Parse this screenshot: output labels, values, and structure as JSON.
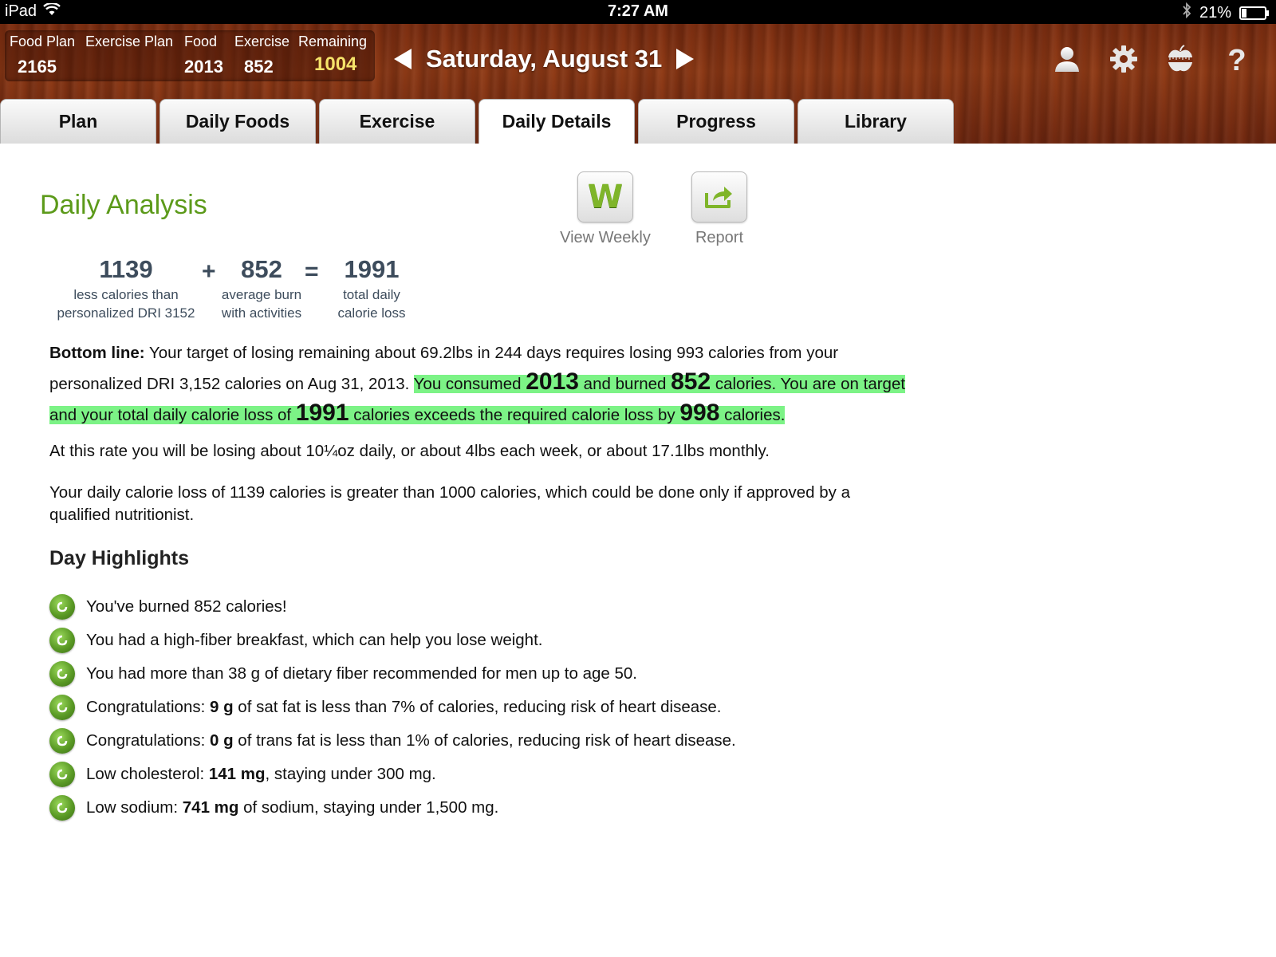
{
  "status_bar": {
    "device": "iPad",
    "time": "7:27 AM",
    "battery": "21%",
    "battery_level": 0.21
  },
  "summary": {
    "food_plan_label": "Food Plan",
    "food_plan_value": "2165",
    "exercise_plan_label": "Exercise Plan",
    "exercise_plan_value": "",
    "food_label": "Food",
    "food_value": "2013",
    "exercise_label": "Exercise",
    "exercise_value": "852",
    "remaining_label": "Remaining",
    "remaining_value": "1004"
  },
  "date_nav": {
    "date": "Saturday, August 31"
  },
  "header_icons": [
    "profile-icon",
    "gear-icon",
    "apple-tape-icon",
    "help-icon"
  ],
  "tabs": [
    {
      "label": "Plan",
      "active": false
    },
    {
      "label": "Daily Foods",
      "active": false
    },
    {
      "label": "Exercise",
      "active": false
    },
    {
      "label": "Daily Details",
      "active": true
    },
    {
      "label": "Progress",
      "active": false
    },
    {
      "label": "Library",
      "active": false
    }
  ],
  "main": {
    "title": "Daily Analysis",
    "view_weekly_label": "View Weekly",
    "view_weekly_glyph": "W",
    "report_label": "Report",
    "equation": {
      "a_value": "1139",
      "a_line1": "less calories than",
      "a_line2": "personalized DRI 3152",
      "plus": "+",
      "b_value": "852",
      "b_line1": "average burn",
      "b_line2": "with activities",
      "equals": "=",
      "c_value": "1991",
      "c_line1": "total daily",
      "c_line2": "calorie loss"
    },
    "bottom_line": {
      "label": "Bottom line:",
      "text1": " Your target of losing remaining about 69.2lbs in 244 days requires losing 993 calories from your personalized DRI 3,152 calories on Aug 31, 2013. ",
      "hl1": "You consumed ",
      "consumed": "2013",
      "hl2": " and burned ",
      "burned": "852",
      "hl3": " calories. You are on target and your total daily calorie loss of ",
      "total_loss": "1991",
      "hl4": " calories exceeds the required calorie loss by ",
      "exceeds": "998",
      "hl5": " calories."
    },
    "rate_text": "At this rate you will be losing about 10¼oz daily, or about 4lbs each week, or about 17.1lbs monthly.",
    "warning_text": "Your daily calorie loss of 1139 calories is greater than 1000 calories, which could be done only if approved by a qualified nutritionist.",
    "highlights_title": "Day Highlights",
    "highlights": [
      {
        "pre": "You've burned 852 calories!",
        "bold": "",
        "post": ""
      },
      {
        "pre": "You had a high-fiber breakfast, which can help you lose weight.",
        "bold": "",
        "post": ""
      },
      {
        "pre": "You had more than 38 g of dietary fiber recommended for men up to age 50.",
        "bold": "",
        "post": ""
      },
      {
        "pre": "Congratulations: ",
        "bold": "9 g",
        "post": " of sat fat is less than 7% of calories, reducing risk of heart disease."
      },
      {
        "pre": "Congratulations: ",
        "bold": "0 g",
        "post": " of trans fat is less than 1% of calories, reducing risk of heart disease."
      },
      {
        "pre": "Low cholesterol: ",
        "bold": "141 mg",
        "post": ", staying under 300 mg."
      },
      {
        "pre": "Low sodium: ",
        "bold": "741 mg",
        "post": " of sodium, staying under 1,500 mg."
      }
    ]
  }
}
